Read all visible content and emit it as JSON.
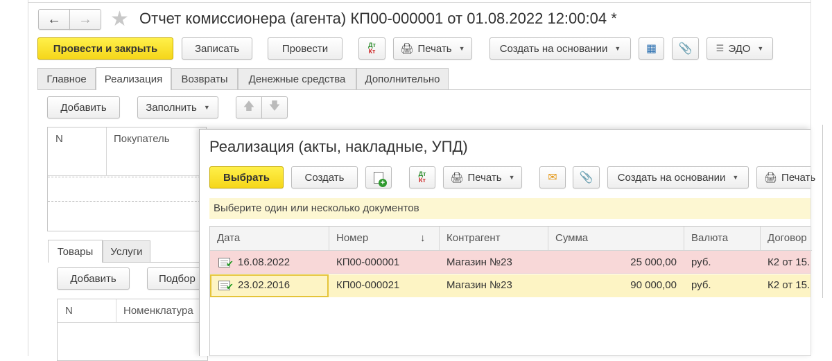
{
  "window": {
    "title": "Отчет комиссионера (агента) КП00-000001 от 01.08.2022 12:00:04 *"
  },
  "toolbar": {
    "post_close": "Провести и закрыть",
    "save": "Записать",
    "post": "Провести",
    "dt": "Дт",
    "kt": "Кт",
    "print": "Печать",
    "create_based": "Создать на основании",
    "edo": "ЭДО"
  },
  "tabs": [
    "Главное",
    "Реализация",
    "Возвраты",
    "Денежные средства",
    "Дополнительно"
  ],
  "realization_panel": {
    "add": "Добавить",
    "fill": "Заполнить",
    "col_n": "N",
    "col_buyer": "Покупатель"
  },
  "subtabs": [
    "Товары",
    "Услуги"
  ],
  "goods_panel": {
    "add": "Добавить",
    "pick": "Подбор",
    "col_n": "N",
    "col_nomenclature": "Номенклатура"
  },
  "dialog": {
    "title": "Реализация (акты, накладные, УПД)",
    "select": "Выбрать",
    "create": "Создать",
    "dt": "Дт",
    "kt": "Кт",
    "print": "Печать",
    "create_based": "Создать на основании",
    "print2": "Печать",
    "hint": "Выберите один или несколько документов",
    "columns": [
      "Дата",
      "Номер",
      "Контрагент",
      "Сумма",
      "Валюта",
      "Договор"
    ],
    "sort_indicator": "↓",
    "rows": [
      {
        "date": "16.08.2022",
        "number": "КП00-000001",
        "counterparty": "Магазин №23",
        "sum": "25 000,00",
        "currency": "руб.",
        "contract": "К2 от 15."
      },
      {
        "date": "23.02.2016",
        "number": "КП00-000021",
        "counterparty": "Магазин №23",
        "sum": "90 000,00",
        "currency": "руб.",
        "contract": "К2 от 15."
      }
    ]
  },
  "colors": {
    "accent_yellow": "#f5d61a",
    "row_pink": "#f8d8d8",
    "row_yellow": "#fdf4c4",
    "selected_border": "#e5c43a"
  }
}
